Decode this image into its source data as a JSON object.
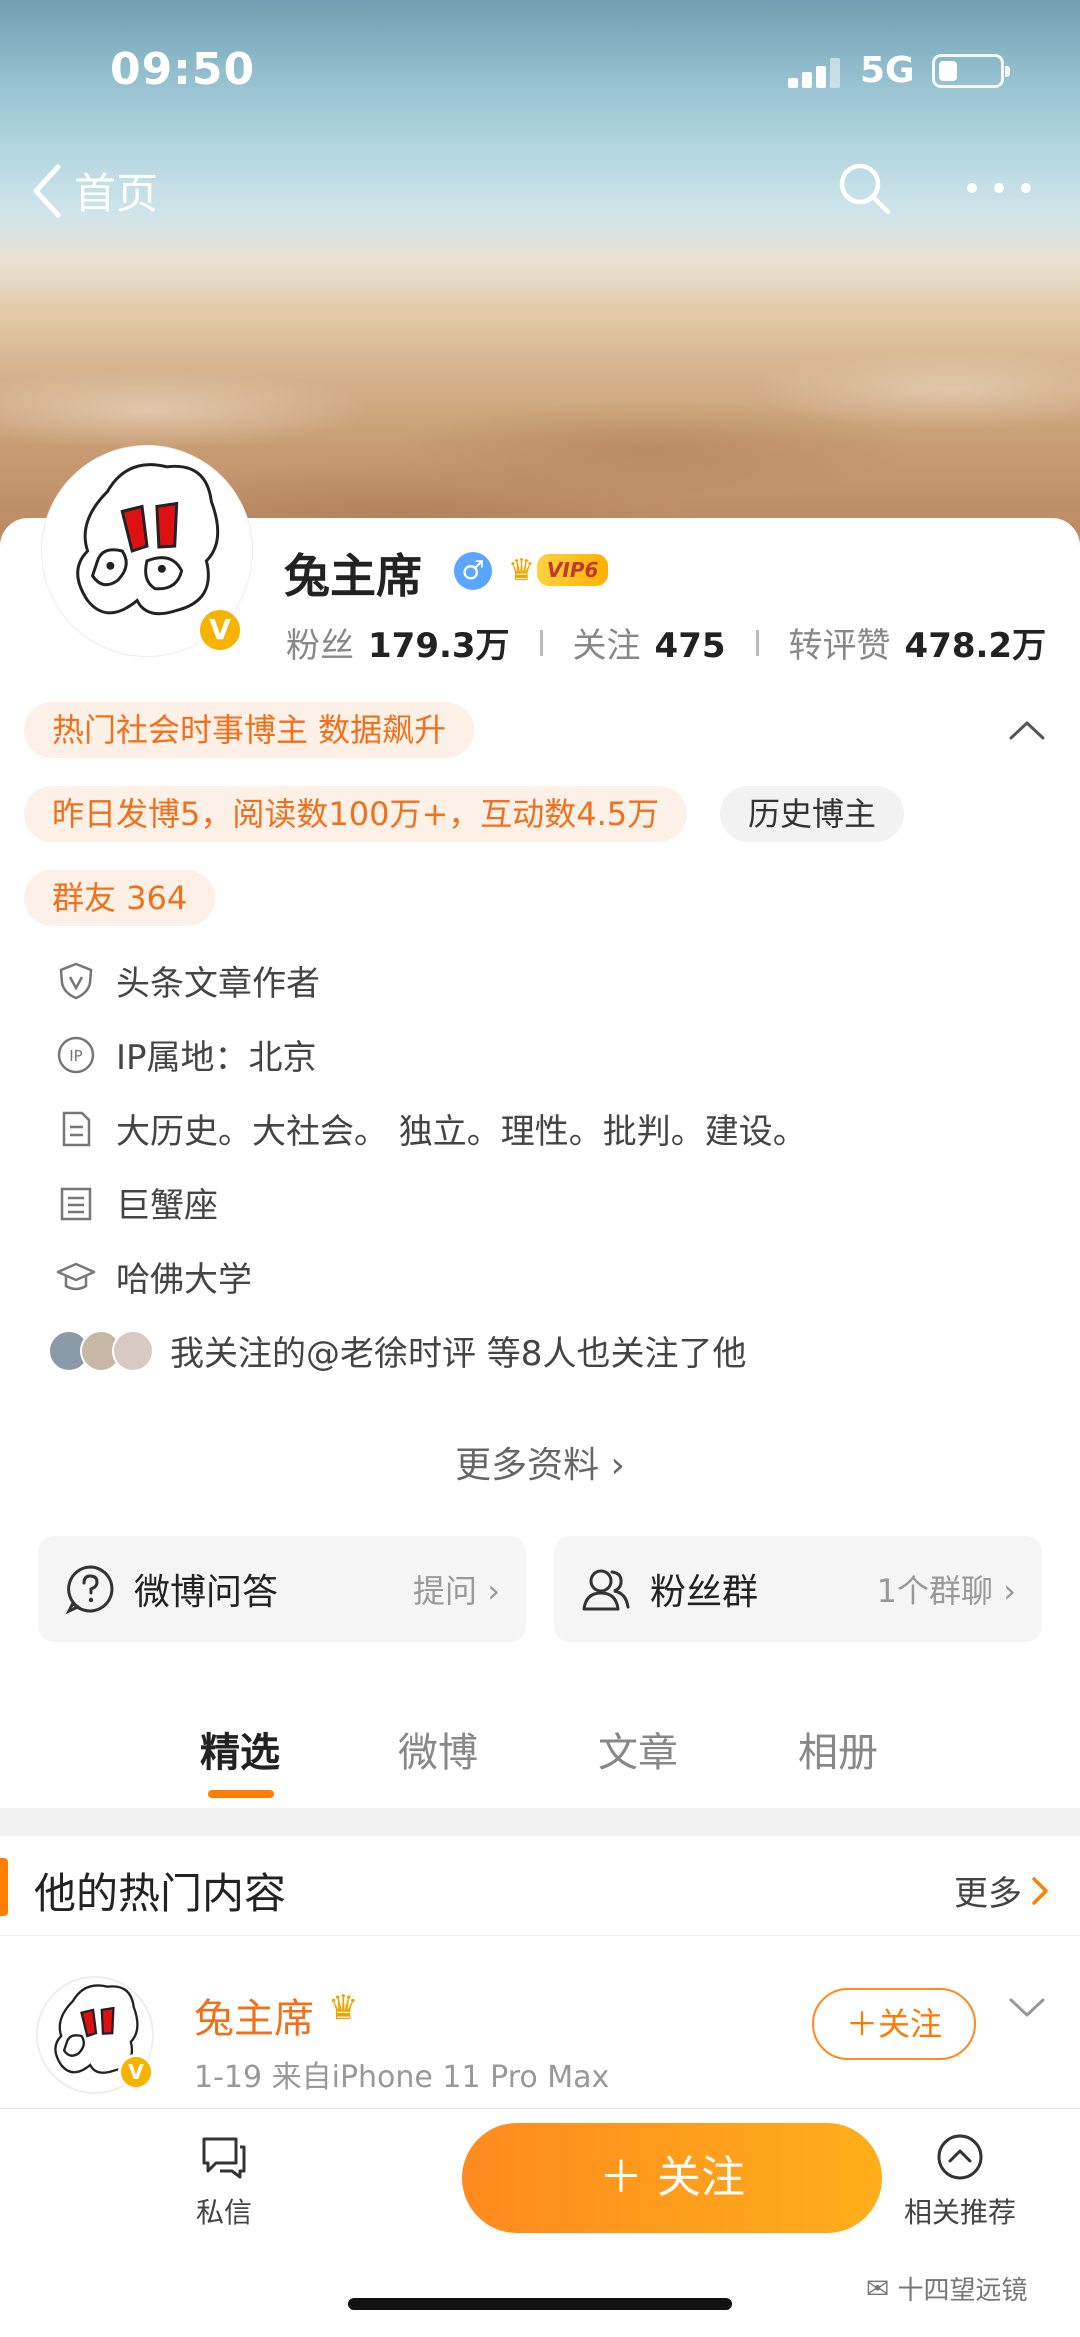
{
  "status": {
    "time": "09:50",
    "network": "5G"
  },
  "nav": {
    "back_label": "首页"
  },
  "profile": {
    "name": "兔主席",
    "gender_symbol": "♂",
    "vip_label": "VIP6",
    "verified_mark": "V",
    "stats": {
      "fans_label": "粉丝",
      "fans_value": "179.3万",
      "follow_label": "关注",
      "follow_value": "475",
      "likes_label": "转评赞",
      "likes_value": "478.2万"
    }
  },
  "tags": {
    "hot_blogger": "热门社会时事博主 数据飙升",
    "yesterday": "昨日发博5，阅读数100万+，互动数4.5万",
    "history": "历史博主",
    "group": "群友 364"
  },
  "info": {
    "author": "头条文章作者",
    "ip": "IP属地：北京",
    "bio": "大历史。大社会。 独立。理性。批判。建设。",
    "zodiac": "巨蟹座",
    "school": "哈佛大学",
    "followed_by": "我关注的@老徐时评 等8人也关注了他"
  },
  "more_info": "更多资料 ›",
  "qa": {
    "label": "微博问答",
    "action": "提问 ›"
  },
  "fans_group": {
    "label": "粉丝群",
    "action": "1个群聊 ›"
  },
  "tabs": [
    "精选",
    "微博",
    "文章",
    "相册"
  ],
  "hot_section": {
    "title": "他的热门内容",
    "more": "更多"
  },
  "post": {
    "author": "兔主席",
    "meta": "1-19  来自iPhone 11 Pro Max",
    "follow": "＋关注"
  },
  "bottom": {
    "message": "私信",
    "follow": "＋ 关注",
    "recommend": "相关推荐"
  },
  "watermark": "十四望远镜",
  "colors": {
    "accent": "#ff8000",
    "tag_orange": "#f0701c",
    "verified": "#f6b400"
  }
}
